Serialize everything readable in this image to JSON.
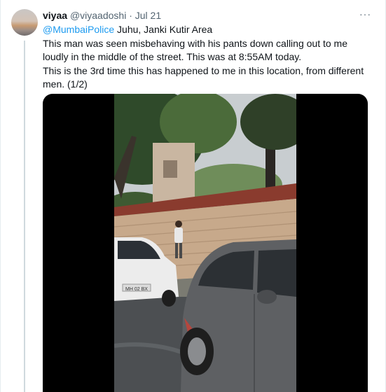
{
  "tweet": {
    "display_name": "viyaa",
    "handle": "@viyaadoshi",
    "separator": " · ",
    "date": "Jul 21",
    "more_label": "···",
    "mention": "@MumbaiPolice",
    "line1_rest": " Juhu, Janki Kutir Area",
    "line2": "This man was seen misbehaving with his pants down calling out to me loudly in the middle of the street. This was at 8:55AM today.",
    "line3": "This is the 3rd time this has happened to me in this location, from different men. (1/2)"
  },
  "media": {
    "car_plate": "MH 02 BX"
  }
}
